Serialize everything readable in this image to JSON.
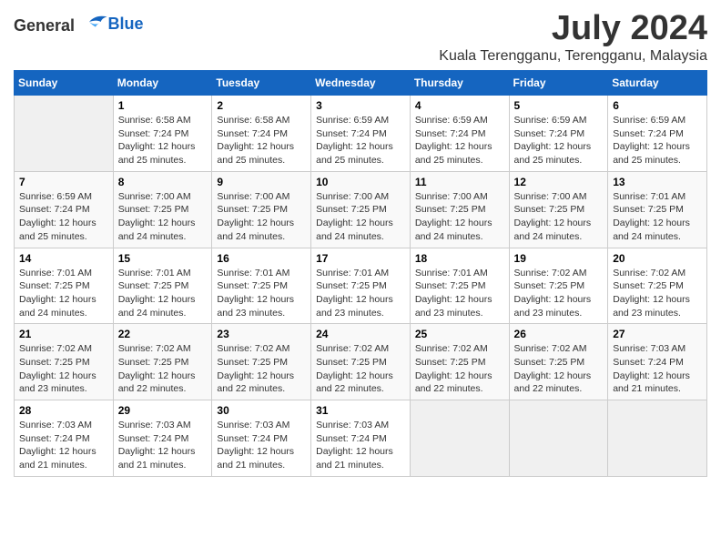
{
  "header": {
    "logo_general": "General",
    "logo_blue": "Blue",
    "month_title": "July 2024",
    "location": "Kuala Terengganu, Terengganu, Malaysia"
  },
  "days_of_week": [
    "Sunday",
    "Monday",
    "Tuesday",
    "Wednesday",
    "Thursday",
    "Friday",
    "Saturday"
  ],
  "weeks": [
    [
      {
        "day": "",
        "info": ""
      },
      {
        "day": "1",
        "info": "Sunrise: 6:58 AM\nSunset: 7:24 PM\nDaylight: 12 hours\nand 25 minutes."
      },
      {
        "day": "2",
        "info": "Sunrise: 6:58 AM\nSunset: 7:24 PM\nDaylight: 12 hours\nand 25 minutes."
      },
      {
        "day": "3",
        "info": "Sunrise: 6:59 AM\nSunset: 7:24 PM\nDaylight: 12 hours\nand 25 minutes."
      },
      {
        "day": "4",
        "info": "Sunrise: 6:59 AM\nSunset: 7:24 PM\nDaylight: 12 hours\nand 25 minutes."
      },
      {
        "day": "5",
        "info": "Sunrise: 6:59 AM\nSunset: 7:24 PM\nDaylight: 12 hours\nand 25 minutes."
      },
      {
        "day": "6",
        "info": "Sunrise: 6:59 AM\nSunset: 7:24 PM\nDaylight: 12 hours\nand 25 minutes."
      }
    ],
    [
      {
        "day": "7",
        "info": "Sunrise: 6:59 AM\nSunset: 7:24 PM\nDaylight: 12 hours\nand 25 minutes."
      },
      {
        "day": "8",
        "info": "Sunrise: 7:00 AM\nSunset: 7:25 PM\nDaylight: 12 hours\nand 24 minutes."
      },
      {
        "day": "9",
        "info": "Sunrise: 7:00 AM\nSunset: 7:25 PM\nDaylight: 12 hours\nand 24 minutes."
      },
      {
        "day": "10",
        "info": "Sunrise: 7:00 AM\nSunset: 7:25 PM\nDaylight: 12 hours\nand 24 minutes."
      },
      {
        "day": "11",
        "info": "Sunrise: 7:00 AM\nSunset: 7:25 PM\nDaylight: 12 hours\nand 24 minutes."
      },
      {
        "day": "12",
        "info": "Sunrise: 7:00 AM\nSunset: 7:25 PM\nDaylight: 12 hours\nand 24 minutes."
      },
      {
        "day": "13",
        "info": "Sunrise: 7:01 AM\nSunset: 7:25 PM\nDaylight: 12 hours\nand 24 minutes."
      }
    ],
    [
      {
        "day": "14",
        "info": "Sunrise: 7:01 AM\nSunset: 7:25 PM\nDaylight: 12 hours\nand 24 minutes."
      },
      {
        "day": "15",
        "info": "Sunrise: 7:01 AM\nSunset: 7:25 PM\nDaylight: 12 hours\nand 24 minutes."
      },
      {
        "day": "16",
        "info": "Sunrise: 7:01 AM\nSunset: 7:25 PM\nDaylight: 12 hours\nand 23 minutes."
      },
      {
        "day": "17",
        "info": "Sunrise: 7:01 AM\nSunset: 7:25 PM\nDaylight: 12 hours\nand 23 minutes."
      },
      {
        "day": "18",
        "info": "Sunrise: 7:01 AM\nSunset: 7:25 PM\nDaylight: 12 hours\nand 23 minutes."
      },
      {
        "day": "19",
        "info": "Sunrise: 7:02 AM\nSunset: 7:25 PM\nDaylight: 12 hours\nand 23 minutes."
      },
      {
        "day": "20",
        "info": "Sunrise: 7:02 AM\nSunset: 7:25 PM\nDaylight: 12 hours\nand 23 minutes."
      }
    ],
    [
      {
        "day": "21",
        "info": "Sunrise: 7:02 AM\nSunset: 7:25 PM\nDaylight: 12 hours\nand 23 minutes."
      },
      {
        "day": "22",
        "info": "Sunrise: 7:02 AM\nSunset: 7:25 PM\nDaylight: 12 hours\nand 22 minutes."
      },
      {
        "day": "23",
        "info": "Sunrise: 7:02 AM\nSunset: 7:25 PM\nDaylight: 12 hours\nand 22 minutes."
      },
      {
        "day": "24",
        "info": "Sunrise: 7:02 AM\nSunset: 7:25 PM\nDaylight: 12 hours\nand 22 minutes."
      },
      {
        "day": "25",
        "info": "Sunrise: 7:02 AM\nSunset: 7:25 PM\nDaylight: 12 hours\nand 22 minutes."
      },
      {
        "day": "26",
        "info": "Sunrise: 7:02 AM\nSunset: 7:25 PM\nDaylight: 12 hours\nand 22 minutes."
      },
      {
        "day": "27",
        "info": "Sunrise: 7:03 AM\nSunset: 7:24 PM\nDaylight: 12 hours\nand 21 minutes."
      }
    ],
    [
      {
        "day": "28",
        "info": "Sunrise: 7:03 AM\nSunset: 7:24 PM\nDaylight: 12 hours\nand 21 minutes."
      },
      {
        "day": "29",
        "info": "Sunrise: 7:03 AM\nSunset: 7:24 PM\nDaylight: 12 hours\nand 21 minutes."
      },
      {
        "day": "30",
        "info": "Sunrise: 7:03 AM\nSunset: 7:24 PM\nDaylight: 12 hours\nand 21 minutes."
      },
      {
        "day": "31",
        "info": "Sunrise: 7:03 AM\nSunset: 7:24 PM\nDaylight: 12 hours\nand 21 minutes."
      },
      {
        "day": "",
        "info": ""
      },
      {
        "day": "",
        "info": ""
      },
      {
        "day": "",
        "info": ""
      }
    ]
  ]
}
